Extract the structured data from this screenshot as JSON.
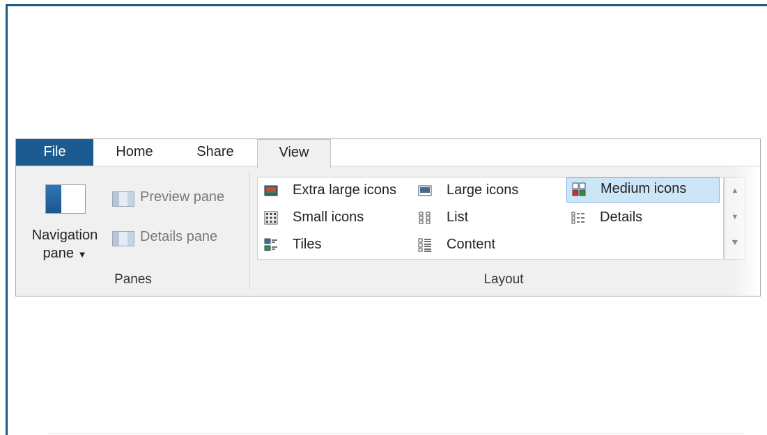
{
  "tabs": {
    "file": "File",
    "home": "Home",
    "share": "Share",
    "view": "View"
  },
  "panes": {
    "navigation_pane": {
      "line1": "Navigation",
      "line2": "pane"
    },
    "preview_pane": "Preview pane",
    "details_pane": "Details pane",
    "group_label": "Panes"
  },
  "layout": {
    "group_label": "Layout",
    "items": [
      {
        "label": "Extra large icons",
        "icon": "extra-large-icons-icon",
        "selected": false
      },
      {
        "label": "Large icons",
        "icon": "large-icons-icon",
        "selected": false
      },
      {
        "label": "Medium icons",
        "icon": "medium-icons-icon",
        "selected": true
      },
      {
        "label": "Small icons",
        "icon": "small-icons-icon",
        "selected": false
      },
      {
        "label": "List",
        "icon": "list-icon",
        "selected": false
      },
      {
        "label": "Details",
        "icon": "details-icon",
        "selected": false
      },
      {
        "label": "Tiles",
        "icon": "tiles-icon",
        "selected": false
      },
      {
        "label": "Content",
        "icon": "content-icon",
        "selected": false
      }
    ]
  },
  "colors": {
    "file_tab": "#1c5b91",
    "selection_fill": "#cde6f7",
    "selection_border": "#7eb4ea",
    "frame": "#1f5a7e"
  }
}
